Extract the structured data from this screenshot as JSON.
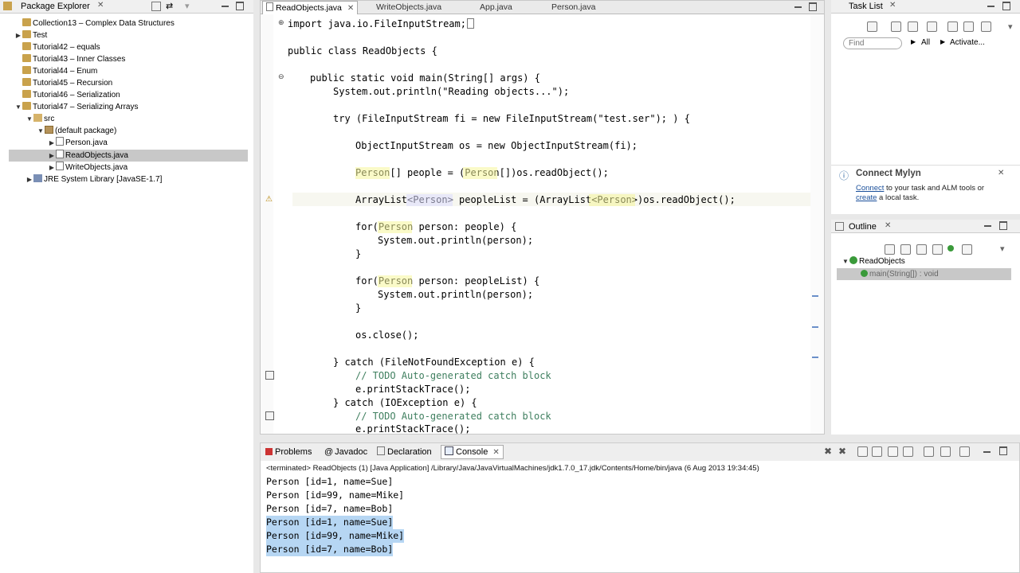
{
  "package_explorer": {
    "title": "Package Explorer",
    "items": [
      {
        "label": "Collection13 – Complex Data Structures"
      },
      {
        "label": "Test"
      },
      {
        "label": "Tutorial42 – equals"
      },
      {
        "label": "Tutorial43 – Inner Classes"
      },
      {
        "label": "Tutorial44 – Enum"
      },
      {
        "label": "Tutorial45 – Recursion"
      },
      {
        "label": "Tutorial46 – Serialization"
      },
      {
        "label": "Tutorial47 – Serializing Arrays"
      },
      {
        "label": "src"
      },
      {
        "label": "(default package)"
      },
      {
        "label": "Person.java"
      },
      {
        "label": "ReadObjects.java"
      },
      {
        "label": "WriteObjects.java"
      },
      {
        "label": "JRE System Library [JavaSE-1.7]"
      }
    ]
  },
  "editor": {
    "tabs": [
      "ReadObjects.java",
      "WriteObjects.java",
      "App.java",
      "Person.java"
    ],
    "lines": [
      "import java.io.FileInputStream;",
      "public class ReadObjects {",
      "public static void main(String[] args) {",
      "System.out.println(\"Reading objects...\");",
      "try (FileInputStream fi = new FileInputStream(\"test.ser\"); ) {",
      "ObjectInputStream os = new ObjectInputStream(fi);",
      "Person[] people = (Person[])os.readObject();",
      "ArrayList<Person> peopleList = (ArrayList<Person>)os.readObject();",
      "for(Person person: people) {",
      "System.out.println(person);",
      "}",
      "for(Person person: peopleList) {",
      "System.out.println(person);",
      "}",
      "os.close();",
      "} catch (FileNotFoundException e) {",
      "// TODO Auto-generated catch block",
      "e.printStackTrace();",
      "} catch (IOException e) {",
      "// TODO Auto-generated catch block",
      "e.printStackTrace();"
    ]
  },
  "task_list": {
    "title": "Task List",
    "find_placeholder": "Find",
    "all_label": "All",
    "activate_label": "Activate...",
    "mylyn_title": "Connect Mylyn",
    "mylyn_connect": "Connect",
    "mylyn_text1": " to your task and ALM tools or",
    "mylyn_create": "create",
    "mylyn_text2": " a local task."
  },
  "outline": {
    "title": "Outline",
    "root": "ReadObjects",
    "child": "main(String[]) : void"
  },
  "console": {
    "tabs": [
      "Problems",
      "Javadoc",
      "Declaration",
      "Console"
    ],
    "status": "<terminated> ReadObjects (1) [Java Application] /Library/Java/JavaVirtualMachines/jdk1.7.0_17.jdk/Contents/Home/bin/java (6 Aug 2013 19:34:45)",
    "lines": [
      "Person [id=1, name=Sue]",
      "Person [id=99, name=Mike]",
      "Person [id=7, name=Bob]",
      "Person [id=1, name=Sue]",
      "Person [id=99, name=Mike]",
      "Person [id=7, name=Bob]"
    ]
  }
}
